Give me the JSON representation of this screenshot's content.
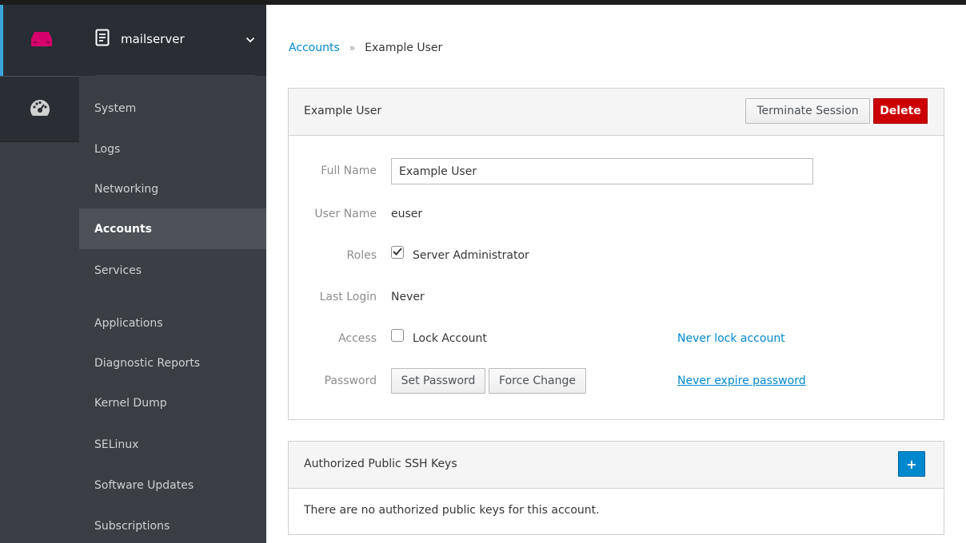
{
  "host": {
    "name": "mailserver"
  },
  "nav": {
    "items": [
      {
        "label": "System"
      },
      {
        "label": "Logs"
      },
      {
        "label": "Networking"
      },
      {
        "label": "Accounts"
      },
      {
        "label": "Services"
      },
      {
        "label": "Applications"
      },
      {
        "label": "Diagnostic Reports"
      },
      {
        "label": "Kernel Dump"
      },
      {
        "label": "SELinux"
      },
      {
        "label": "Software Updates"
      },
      {
        "label": "Subscriptions"
      }
    ],
    "active": "Accounts"
  },
  "breadcrumb": {
    "parent": "Accounts",
    "separator": "»",
    "current": "Example User"
  },
  "account_panel": {
    "title": "Example User",
    "terminate_label": "Terminate Session",
    "delete_label": "Delete",
    "fields": {
      "full_name_label": "Full Name",
      "full_name_value": "Example User",
      "user_name_label": "User Name",
      "user_name_value": "euser",
      "roles_label": "Roles",
      "roles_option": "Server Administrator",
      "roles_checked": true,
      "last_login_label": "Last Login",
      "last_login_value": "Never",
      "access_label": "Access",
      "access_option": "Lock Account",
      "access_checked": false,
      "access_link": "Never lock account",
      "password_label": "Password",
      "set_password_label": "Set Password",
      "force_change_label": "Force Change",
      "password_link": "Never expire password"
    }
  },
  "ssh_panel": {
    "title": "Authorized Public SSH Keys",
    "add_label": "+",
    "empty_text": "There are no authorized public keys for this account."
  },
  "colors": {
    "accent": "#0088ce",
    "danger": "#cc0000",
    "host_icon": "#d6006d",
    "sidebar": "#393f44",
    "active_nav": "#4d5258"
  }
}
